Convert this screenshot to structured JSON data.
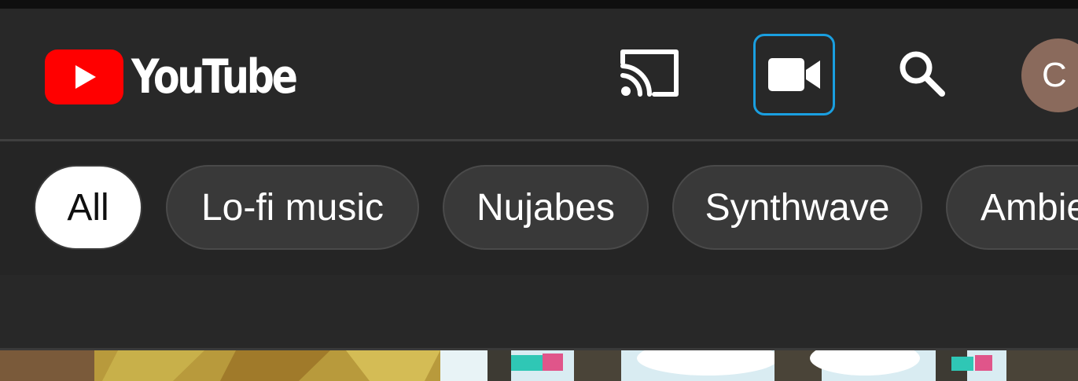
{
  "app": {
    "name": "YouTube",
    "brand_color": "#ff0000"
  },
  "header": {
    "icons": {
      "cast": "cast-icon",
      "create": "video-camera-icon",
      "search": "search-icon"
    },
    "focus_ring_color": "#1a9fe0",
    "avatar": {
      "initial": "C",
      "color": "#8a6a5c"
    }
  },
  "chips": [
    {
      "label": "All",
      "selected": true
    },
    {
      "label": "Lo-fi music",
      "selected": false
    },
    {
      "label": "Nujabes",
      "selected": false
    },
    {
      "label": "Synthwave",
      "selected": false
    },
    {
      "label": "Ambie",
      "selected": false
    }
  ]
}
